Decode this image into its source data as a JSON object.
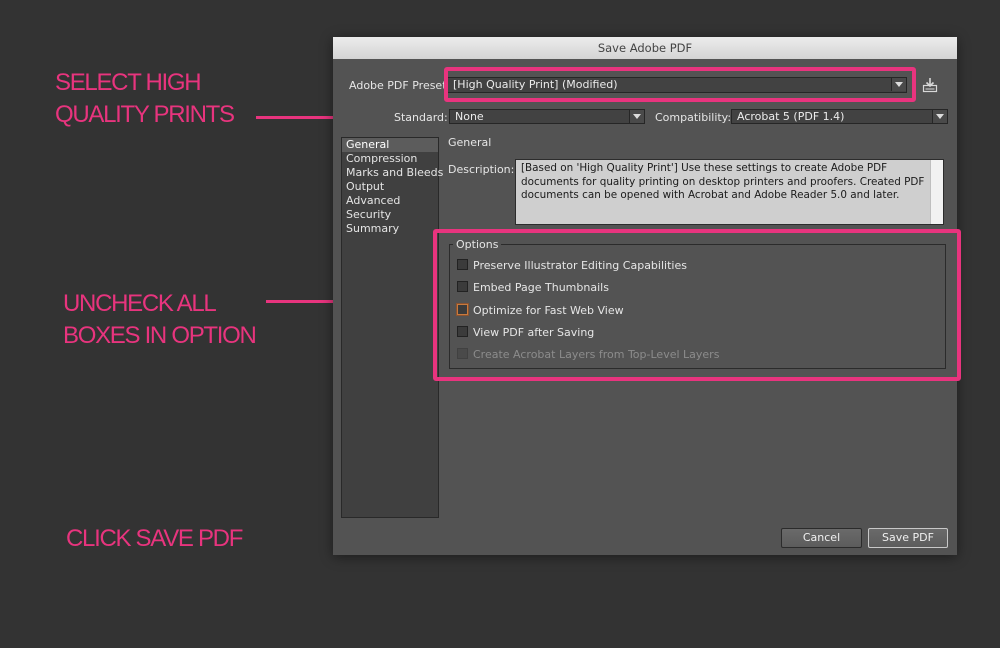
{
  "annotations": {
    "select_preset": [
      "SELECT HIGH",
      "QUALITY PRINTS"
    ],
    "uncheck_options": [
      "UNCHECK ALL",
      "BOXES IN OPTION"
    ],
    "click_save": "CLICK SAVE PDF",
    "color": "#e8347e"
  },
  "dialog": {
    "title": "Save Adobe PDF",
    "preset": {
      "label": "Adobe PDF Preset:",
      "value": "[High Quality Print] (Modified)"
    },
    "preset_save_icon": "save-preset-icon",
    "standard": {
      "label": "Standard:",
      "value": "None"
    },
    "compatibility": {
      "label": "Compatibility:",
      "value": "Acrobat 5 (PDF 1.4)"
    },
    "nav": [
      {
        "label": "General",
        "selected": true
      },
      {
        "label": "Compression"
      },
      {
        "label": "Marks and Bleeds"
      },
      {
        "label": "Output"
      },
      {
        "label": "Advanced"
      },
      {
        "label": "Security"
      },
      {
        "label": "Summary"
      }
    ],
    "panel_title": "General",
    "description": {
      "label": "Description:",
      "text": "[Based on 'High Quality Print'] Use these settings to create Adobe PDF documents for quality printing on desktop printers and proofers.  Created PDF documents can be opened with Acrobat and Adobe Reader 5.0 and later."
    },
    "options": {
      "title": "Options",
      "items": [
        {
          "label": "Preserve Illustrator Editing Capabilities",
          "checked": false
        },
        {
          "label": "Embed Page Thumbnails",
          "checked": false
        },
        {
          "label": "Optimize for Fast Web View",
          "checked": false
        },
        {
          "label": "View PDF after Saving",
          "checked": false
        },
        {
          "label": "Create Acrobat Layers from Top-Level Layers",
          "checked": false,
          "disabled": true
        }
      ]
    },
    "buttons": {
      "cancel": "Cancel",
      "save": "Save PDF"
    }
  }
}
